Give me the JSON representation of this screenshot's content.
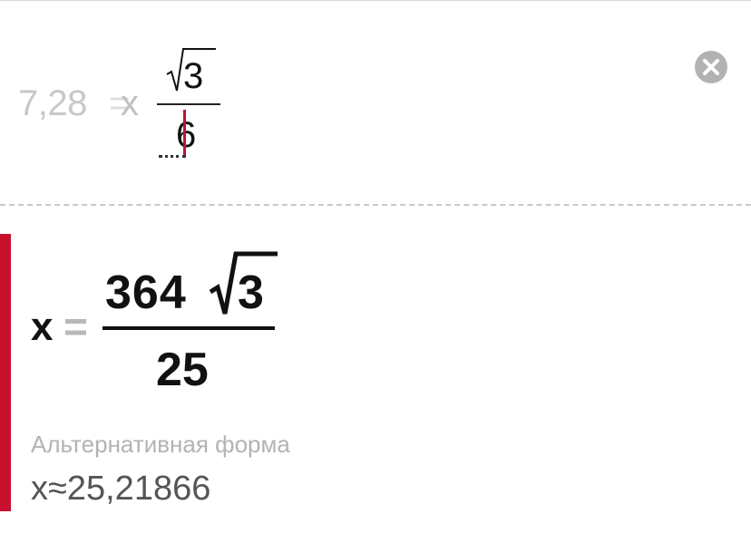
{
  "input": {
    "lhs": "7,28",
    "eq": "=",
    "var": "x",
    "numerator_radicand": "3",
    "denominator": "6"
  },
  "controls": {
    "clear_icon": "close-circle-icon"
  },
  "result": {
    "var": "x",
    "eq": "=",
    "numerator_coef": "364",
    "numerator_radicand": "3",
    "denominator": "25"
  },
  "alternative": {
    "label": "Альтернативная форма",
    "value": "x≈25,21866"
  },
  "colors": {
    "accent": "#c8102e",
    "cursor": "#c0113a",
    "muted": "#b3b3b3"
  }
}
